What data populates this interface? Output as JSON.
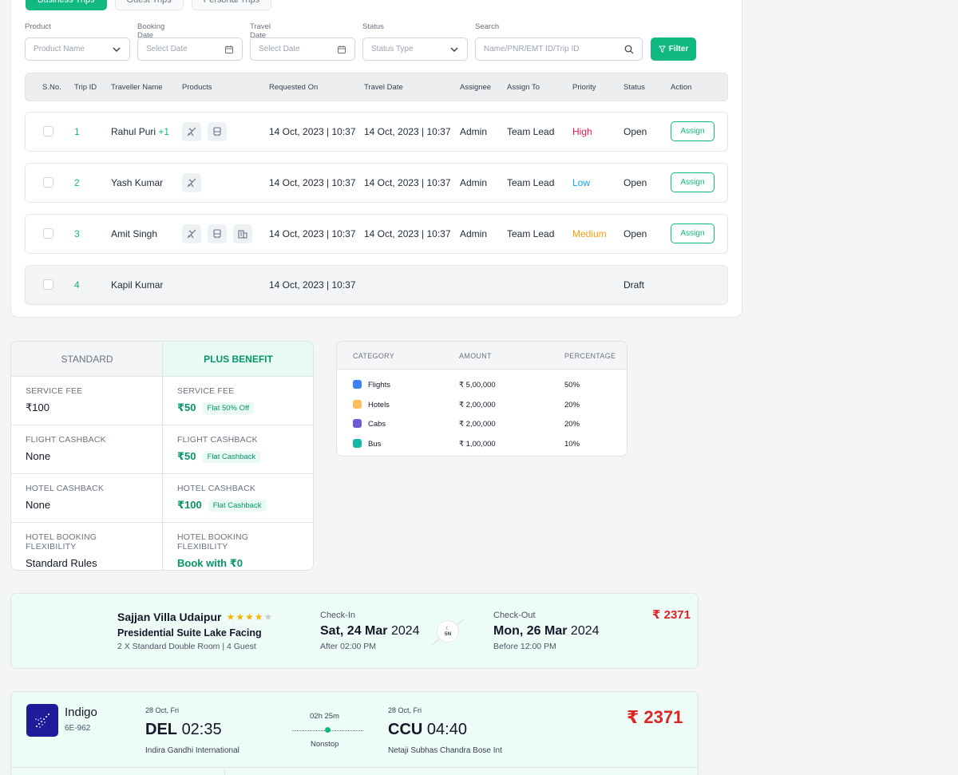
{
  "tabs": [
    "Business Trips",
    "Guest Trips",
    "Personal Trips"
  ],
  "filters": {
    "product": {
      "label": "Product",
      "placeholder": "Product Name"
    },
    "booking_date": {
      "label": "Booking Date",
      "placeholder": "Select Date"
    },
    "travel_date": {
      "label": "Travel Date",
      "placeholder": "Select Date"
    },
    "status": {
      "label": "Status",
      "placeholder": "Status Type"
    },
    "search": {
      "label": "Search",
      "placeholder": "Name/PNR/EMT ID/Trip ID"
    },
    "filter_button": "Filter"
  },
  "table": {
    "headers": [
      "S.No.",
      "Trip ID",
      "Traveller Name",
      "Products",
      "Requested On",
      "Travel Date",
      "Assignee",
      "Assign To",
      "Priority",
      "Status",
      "Action"
    ],
    "rows": [
      {
        "id": "1",
        "name": "Rahul Puri",
        "extra": "+1",
        "products": [
          "flight-icon",
          "bus-icon"
        ],
        "requested": "14 Oct, 2023 | 10:37",
        "travel": "14 Oct, 2023 | 10:37",
        "assignee": "Admin",
        "assign_to": "Team Lead",
        "priority": "High",
        "status": "Open",
        "action": "Assign"
      },
      {
        "id": "2",
        "name": "Yash Kumar",
        "extra": "",
        "products": [
          "flight-icon"
        ],
        "requested": "14 Oct, 2023 | 10:37",
        "travel": "14 Oct, 2023 | 10:37",
        "assignee": "Admin",
        "assign_to": "Team Lead",
        "priority": "Low",
        "status": "Open",
        "action": "Assign"
      },
      {
        "id": "3",
        "name": "Amit Singh",
        "extra": "",
        "products": [
          "flight-icon",
          "bus-icon",
          "hotel-icon"
        ],
        "requested": "14 Oct, 2023 | 10:37",
        "travel": "14 Oct, 2023 | 10:37",
        "assignee": "Admin",
        "assign_to": "Team Lead",
        "priority": "Medium",
        "status": "Open",
        "action": "Assign"
      },
      {
        "id": "4",
        "name": "Kapil Kumar",
        "extra": "",
        "products": [],
        "requested": "14 Oct, 2023 | 10:37",
        "travel": "",
        "assignee": "",
        "assign_to": "",
        "priority": "",
        "status": "Draft",
        "action": ""
      }
    ]
  },
  "benefits": {
    "standard_title": "STANDARD",
    "plus_title": "PLUS BENEFIT",
    "rows": [
      {
        "label": "SERVICE FEE",
        "standard": "₹100",
        "plus": "₹50",
        "plus_tag": "Flat 50% Off"
      },
      {
        "label": "FLIGHT CASHBACK",
        "standard": "None",
        "plus": "₹50",
        "plus_tag": "Flat Cashback"
      },
      {
        "label": "HOTEL CASHBACK",
        "standard": "None",
        "plus": "₹100",
        "plus_tag": "Flat Cashback"
      },
      {
        "label": "HOTEL BOOKING FLEXIBILITY",
        "standard": "Standard Rules",
        "plus": "Book with ₹0",
        "plus_tag": ""
      }
    ]
  },
  "categories": {
    "headers": [
      "CATEGORY",
      "AMOUNT",
      "PERCENTAGE"
    ],
    "rows": [
      {
        "name": "Flights",
        "amount": "₹ 5,00,000",
        "percent": "50%",
        "color": "#3b82f6"
      },
      {
        "name": "Hotels",
        "amount": "₹ 2,00,000",
        "percent": "20%",
        "color": "#fbbf60"
      },
      {
        "name": "Cabs",
        "amount": "₹ 2,00,000",
        "percent": "20%",
        "color": "#6d5bd0"
      },
      {
        "name": "Bus",
        "amount": "₹ 1,00,000",
        "percent": "10%",
        "color": "#14b8a6"
      }
    ]
  },
  "hotel": {
    "name": "Sajjan Villa Udaipur",
    "stars": 4,
    "room": "Presidential Suite Lake Facing",
    "details": "2 X Standard Double Room | 4 Guest",
    "checkin_label": "Check-In",
    "checkin_day": "Sat, 24 Mar",
    "checkin_year": "2024",
    "checkin_time": "After 02:00 PM",
    "nights": "5N",
    "checkout_label": "Check-Out",
    "checkout_day": "Mon, 26 Mar",
    "checkout_year": "2024",
    "checkout_time": "Before 12:00 PM",
    "price": "₹ 2371"
  },
  "flight": {
    "airline": "Indigo",
    "code": "6E-962",
    "dep_date": "28 Oct, Fri",
    "dep_city": "DEL",
    "dep_time": "02:35",
    "dep_airport": "Indira Gandhi International",
    "duration": "02h 25m",
    "stops": "Nonstop",
    "arr_date": "28 Oct, Fri",
    "arr_city": "CCU",
    "arr_time": "04:40",
    "arr_airport": "Netaji Subhas Chandra Bose Int",
    "price": "₹ 2371"
  }
}
